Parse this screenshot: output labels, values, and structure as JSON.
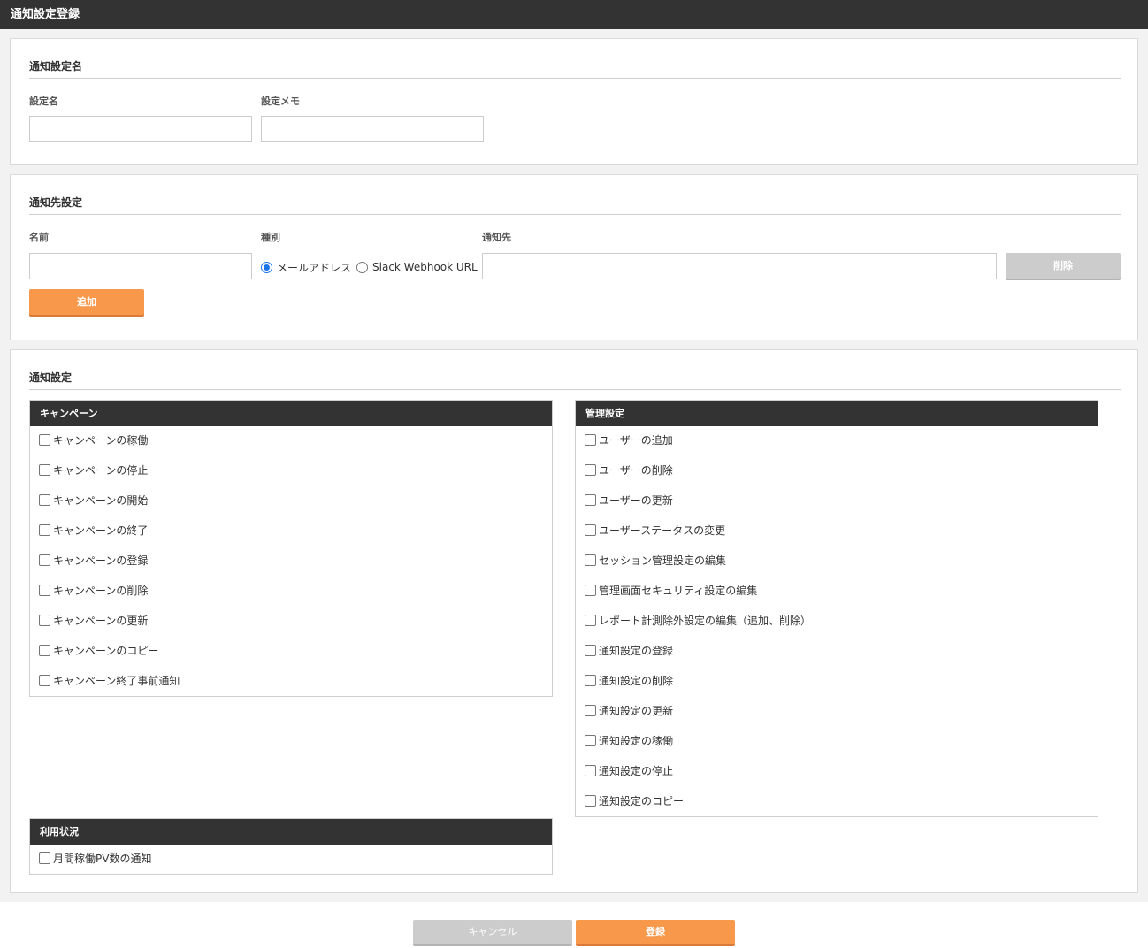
{
  "header": {
    "title": "通知設定登録"
  },
  "name_section": {
    "title": "通知設定名",
    "name_label": "設定名",
    "name_value": "",
    "memo_label": "設定メモ",
    "memo_value": ""
  },
  "destination_section": {
    "title": "通知先設定",
    "name_label": "名前",
    "type_label": "種別",
    "target_label": "通知先",
    "type_options": [
      "メールアドレス",
      "Slack Webhook URL"
    ],
    "type_selected": "メールアドレス",
    "delete_label": "削除",
    "add_label": "追加"
  },
  "notify_section": {
    "title": "通知設定",
    "campaign": {
      "title": "キャンペーン",
      "items": [
        "キャンペーンの稼働",
        "キャンペーンの停止",
        "キャンペーンの開始",
        "キャンペーンの終了",
        "キャンペーンの登録",
        "キャンペーンの削除",
        "キャンペーンの更新",
        "キャンペーンのコピー",
        "キャンペーン終了事前通知"
      ]
    },
    "admin": {
      "title": "管理設定",
      "items": [
        "ユーザーの追加",
        "ユーザーの削除",
        "ユーザーの更新",
        "ユーザーステータスの変更",
        "セッション管理設定の編集",
        "管理画面セキュリティ設定の編集",
        "レポート計測除外設定の編集（追加、削除）",
        "通知設定の登録",
        "通知設定の削除",
        "通知設定の更新",
        "通知設定の稼働",
        "通知設定の停止",
        "通知設定のコピー"
      ]
    },
    "usage": {
      "title": "利用状況",
      "items": [
        "月間稼働PV数の通知"
      ]
    }
  },
  "footer": {
    "cancel_label": "キャンセル",
    "submit_label": "登録"
  },
  "colors": {
    "accent": "#f7984a",
    "header_bg": "#333333",
    "disabled": "#cccccc"
  }
}
